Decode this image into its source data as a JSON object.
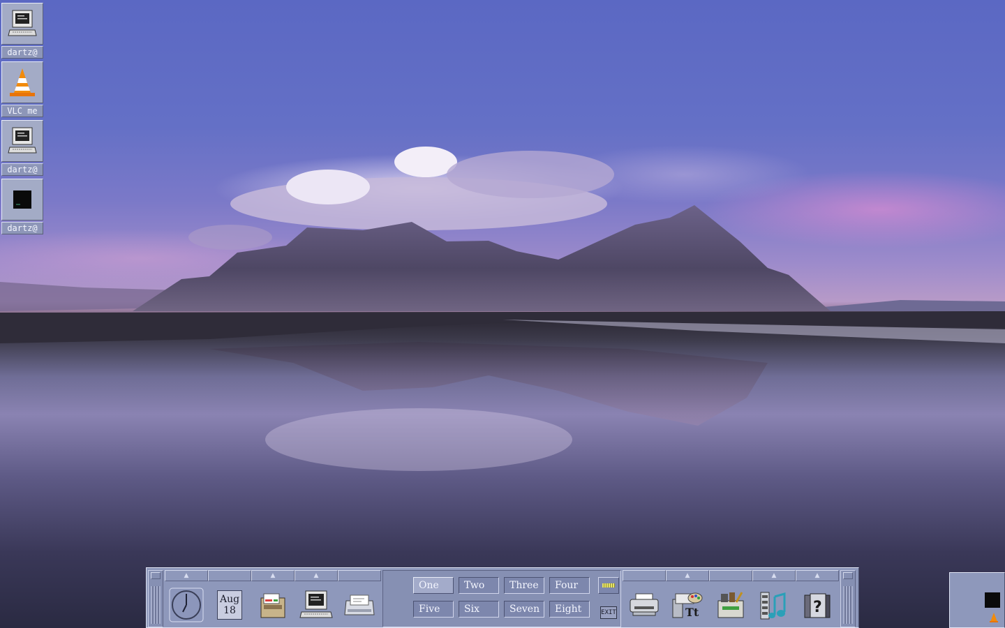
{
  "desktop": {
    "icons": [
      {
        "label": "dartz@",
        "icon": "terminal-computer-icon"
      },
      {
        "label": "VLC me",
        "icon": "vlc-cone-icon"
      },
      {
        "label": "dartz@",
        "icon": "terminal-computer-icon"
      },
      {
        "label": "dartz@",
        "icon": "black-terminal-icon"
      }
    ]
  },
  "front_panel": {
    "calendar": {
      "month": "Aug",
      "day": "18"
    },
    "workspaces": [
      "One",
      "Two",
      "Three",
      "Four",
      "Five",
      "Six",
      "Seven",
      "Eight"
    ],
    "active_workspace": "One",
    "exit_label": "EXIT",
    "left_icons": [
      "clock-icon",
      "calendar-icon",
      "file-manager-icon",
      "terminal-icon",
      "mailer-icon"
    ],
    "right_icons": [
      "printer-icon",
      "style-manager-icon",
      "app-manager-icon",
      "media-player-icon",
      "help-icon"
    ],
    "colors": {
      "panel": "#8e98bb",
      "active_ws": "#a3abca"
    }
  }
}
